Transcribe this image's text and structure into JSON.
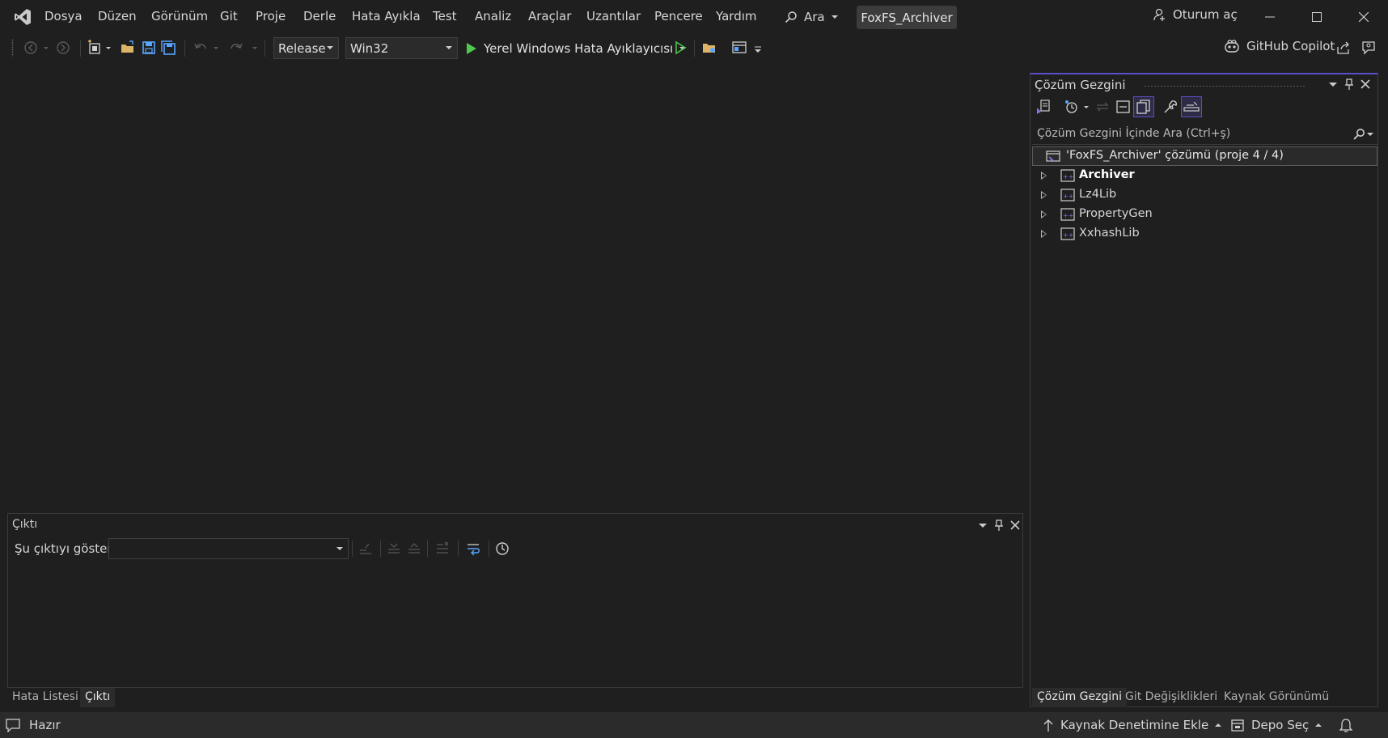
{
  "menu": {
    "items": [
      "Dosya",
      "Düzen",
      "Görünüm",
      "Git",
      "Proje",
      "Derle",
      "Hata Ayıkla",
      "Test",
      "Analiz",
      "Araçlar",
      "Uzantılar",
      "Pencere",
      "Yardım"
    ],
    "search_label": "Ara",
    "solution_name": "FoxFS_Archiver",
    "signin_label": "Oturum aç"
  },
  "toolbar": {
    "configuration": "Release",
    "platform": "Win32",
    "start_label": "Yerel Windows Hata Ayıklayıcısı",
    "copilot_label": "GitHub Copilot"
  },
  "output": {
    "title": "Çıktı",
    "show_label": "Şu çıktıyı göster:",
    "source_value": ""
  },
  "bottom_tabs_left": [
    "Hata Listesi",
    "Çıktı"
  ],
  "solution_explorer": {
    "title": "Çözüm Gezgini",
    "search_placeholder": "Çözüm Gezgini İçinde Ara (Ctrl+ş)",
    "root_label": "'FoxFS_Archiver' çözümü (proje 4 / 4)",
    "projects": [
      "Archiver",
      "Lz4Lib",
      "PropertyGen",
      "XxhashLib"
    ],
    "startup_project": "Archiver"
  },
  "bottom_tabs_right": [
    "Çözüm Gezgini",
    "Git Değişiklikleri",
    "Kaynak Görünümü"
  ],
  "status": {
    "ready": "Hazır",
    "source_control": "Kaynak Denetimine Ekle",
    "repo": "Depo Seç"
  },
  "colors": {
    "accent": "#5a4fc6",
    "vs_purple": "#8c6ee6",
    "run_green": "#4ec94e",
    "folder_yellow": "#dcb567",
    "save_blue": "#58a6ff"
  }
}
